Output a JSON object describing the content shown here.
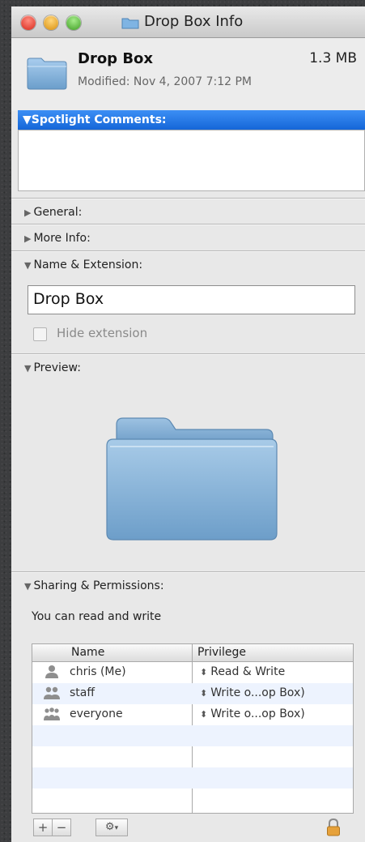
{
  "window": {
    "title": "Drop Box Info"
  },
  "item": {
    "name": "Drop Box",
    "size": "1.3 MB",
    "modified": "Modified: Nov 4, 2007 7:12 PM"
  },
  "sections": {
    "spotlight": "Spotlight Comments:",
    "general": "General:",
    "more_info": "More Info:",
    "name_ext": "Name & Extension:",
    "preview": "Preview:",
    "sharing": "Sharing & Permissions:"
  },
  "name_field": {
    "value": "Drop Box"
  },
  "hide_extension": {
    "label": "Hide extension",
    "checked": false
  },
  "permissions": {
    "summary": "You can read and write",
    "columns": [
      "Name",
      "Privilege"
    ],
    "rows": [
      {
        "name": "chris (Me)",
        "privilege": "Read & Write",
        "icon": "single-user-icon"
      },
      {
        "name": "staff",
        "privilege": "Write o...op Box)",
        "icon": "group-icon"
      },
      {
        "name": "everyone",
        "privilege": "Write o...op Box)",
        "icon": "everyone-icon"
      }
    ]
  },
  "toolbar": {
    "add": "+",
    "remove": "−",
    "action": "⚙",
    "action_arrow": "▾"
  },
  "colors": {
    "selection": "#1566d8",
    "lock": "#e6a13a"
  }
}
